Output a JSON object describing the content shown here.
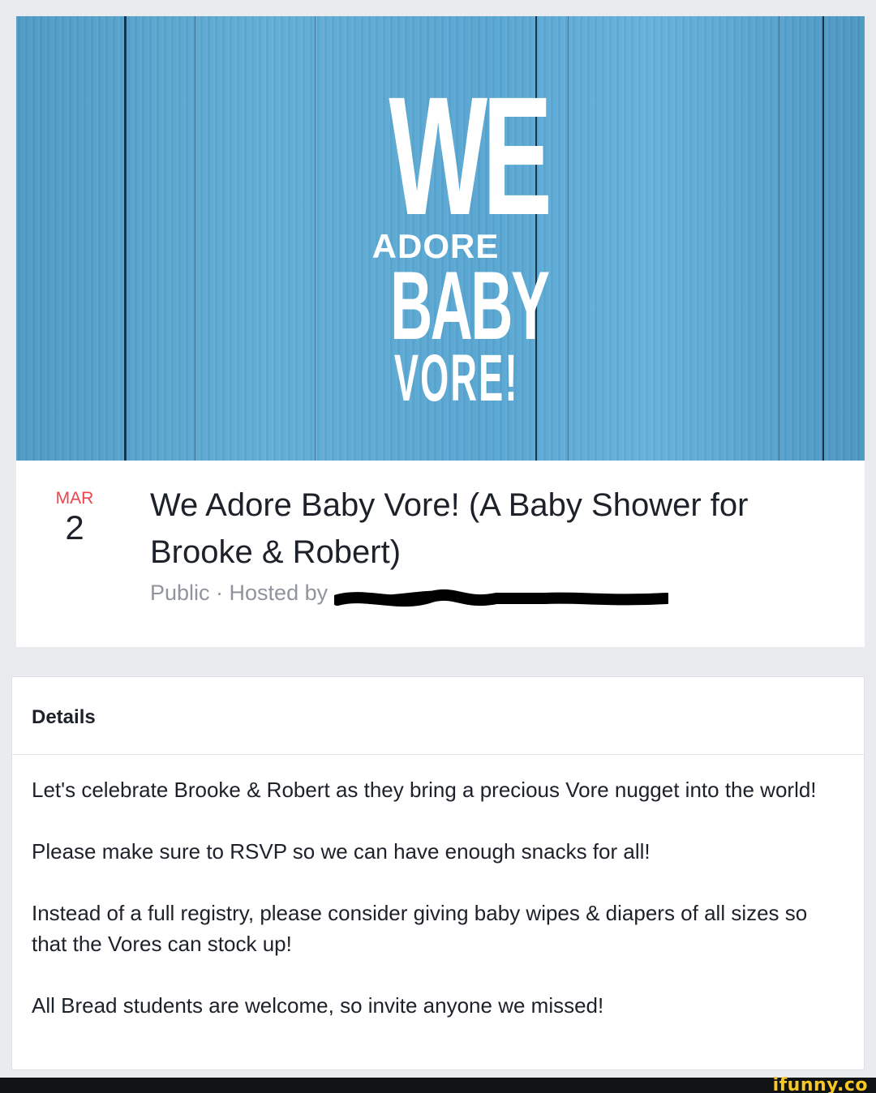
{
  "cover": {
    "logo": {
      "line1": "WE",
      "line2": "ADORE",
      "line3": "BABY",
      "line4": "VORE!"
    },
    "background_color": "#5aa8d4"
  },
  "event": {
    "date": {
      "month": "MAR",
      "day": "2"
    },
    "title": "We Adore Baby Vore! (A Baby Shower for Brooke & Robert)",
    "meta": "Public · Hosted by"
  },
  "details": {
    "heading": "Details",
    "paragraphs": [
      "Let's celebrate Brooke & Robert as they bring a precious Vore nugget into the world!",
      "Please make sure to RSVP so we can have enough snacks for all!",
      "Instead of a full registry, please consider giving baby wipes & diapers of all sizes so that the Vores can stock up!",
      "All Bread students are welcome, so invite anyone we missed!"
    ]
  },
  "footer": {
    "watermark": "ifunny.co"
  },
  "colors": {
    "month_accent": "#e9464d",
    "meta_gray": "#90949c",
    "watermark_yellow": "#f7c824"
  }
}
